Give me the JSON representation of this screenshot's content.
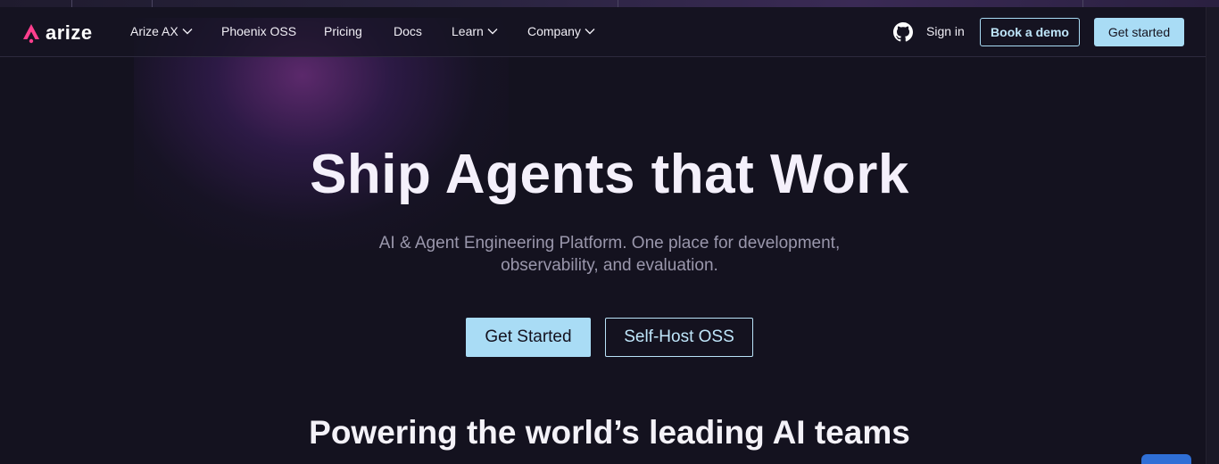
{
  "brand": {
    "name": "arize",
    "accent": "#ff3f8e"
  },
  "nav": {
    "items": [
      {
        "label": "Arize AX",
        "dropdown": true
      },
      {
        "label": "Phoenix OSS",
        "dropdown": false
      },
      {
        "label": "Pricing",
        "dropdown": false
      },
      {
        "label": "Docs",
        "dropdown": false
      },
      {
        "label": "Learn",
        "dropdown": true
      },
      {
        "label": "Company",
        "dropdown": true
      }
    ],
    "github_icon": "github-icon",
    "sign_in": "Sign in",
    "book_demo": "Book a demo",
    "get_started": "Get started"
  },
  "hero": {
    "title": "Ship Agents that Work",
    "subtitle": "AI & Agent Engineering Platform. One place for development, observability, and evaluation.",
    "primary_cta": "Get Started",
    "secondary_cta": "Self-Host OSS"
  },
  "customers": {
    "title": "Powering the world’s leading AI teams"
  },
  "colors": {
    "background": "#14121f",
    "cta": "#a9dcf5",
    "chat": "#2f6fd6"
  }
}
